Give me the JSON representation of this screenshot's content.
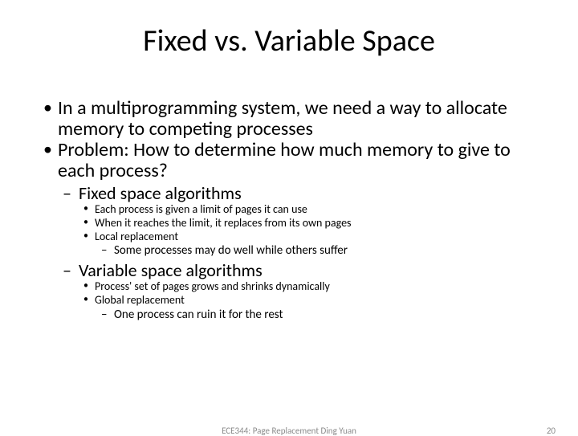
{
  "title": "Fixed vs. Variable Space",
  "bullets": {
    "b1": "In a multiprogramming system, we need a way to allocate memory to competing processes",
    "b2": "Problem: How to determine how much memory to give to each process?",
    "fixed": {
      "heading": "Fixed space algorithms",
      "i1": "Each process is given a limit of pages it can use",
      "i2": "When it reaches the limit, it replaces from its own pages",
      "i3": "Local replacement",
      "i3a": "Some processes may do well while others suffer"
    },
    "variable": {
      "heading": "Variable space algorithms",
      "i1": "Process' set of pages grows and shrinks dynamically",
      "i2": "Global replacement",
      "i2a": "One process can ruin it for the rest"
    }
  },
  "footer": {
    "center": "ECE344: Page Replacement Ding Yuan",
    "pagenum": "20"
  }
}
